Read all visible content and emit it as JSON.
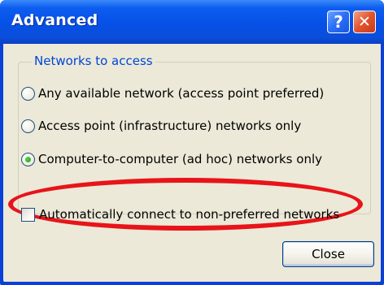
{
  "window": {
    "title": "Advanced",
    "help_button_label": "?",
    "close_button_label": "✕"
  },
  "networks_group": {
    "legend": "Networks to access",
    "options": [
      {
        "label": "Any available network (access point preferred)",
        "selected": false
      },
      {
        "label": "Access point (infrastructure) networks only",
        "selected": false
      },
      {
        "label": "Computer-to-computer (ad hoc) networks only",
        "selected": true
      }
    ]
  },
  "auto_connect": {
    "label": "Automatically connect to non-preferred networks",
    "checked": false
  },
  "footer": {
    "close_label": "Close"
  },
  "colors": {
    "titlebar": "#0650e6",
    "dialog_bg": "#ece9d8",
    "group_legend": "#0046d5",
    "highlight": "#e8141a"
  }
}
